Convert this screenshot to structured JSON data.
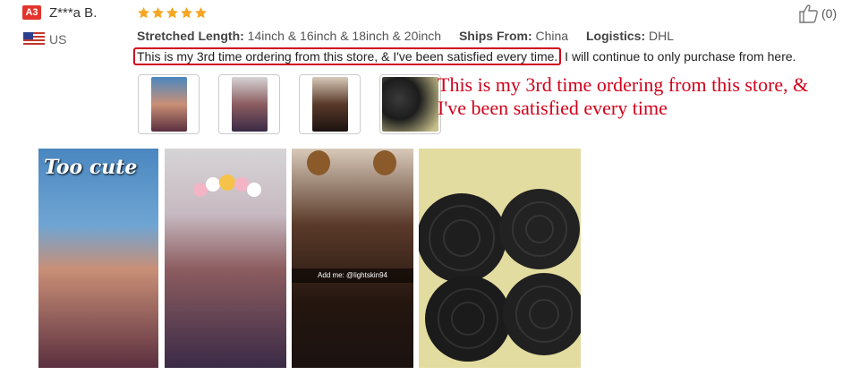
{
  "reviewer": {
    "badge": "A3",
    "name": "Z***a B.",
    "country_code": "US",
    "flag_icon": "us-flag-icon"
  },
  "rating": {
    "stars": 5,
    "max": 5,
    "color": "#f5a623"
  },
  "helpful": {
    "icon": "thumbs-up-icon",
    "count_label": "(0)"
  },
  "attributes": [
    {
      "key": "Stretched Length:",
      "value": "14inch & 16inch & 18inch & 20inch"
    },
    {
      "key": "Ships From:",
      "value": "China"
    },
    {
      "key": "Logistics:",
      "value": "DHL"
    }
  ],
  "review": {
    "highlighted": "This is my 3rd time ordering from this store, & I've been satisfied every time.",
    "rest": " I will continue to only purchase from here."
  },
  "callout": {
    "text": "This is my 3rd time ordering from this store, & I've been satisfied every time",
    "color": "#d0021b"
  },
  "thumbnails": [
    {
      "name": "review-photo-thumb-1",
      "color": "#6b4a5c"
    },
    {
      "name": "review-photo-thumb-2",
      "color": "#7a5e78"
    },
    {
      "name": "review-photo-thumb-3",
      "color": "#3b2a20"
    },
    {
      "name": "review-photo-thumb-4",
      "color": "#2b2b2b"
    }
  ],
  "photos": {
    "p1_overlay": "Too cute",
    "p3_caption": "Add me: @lightskin94"
  }
}
